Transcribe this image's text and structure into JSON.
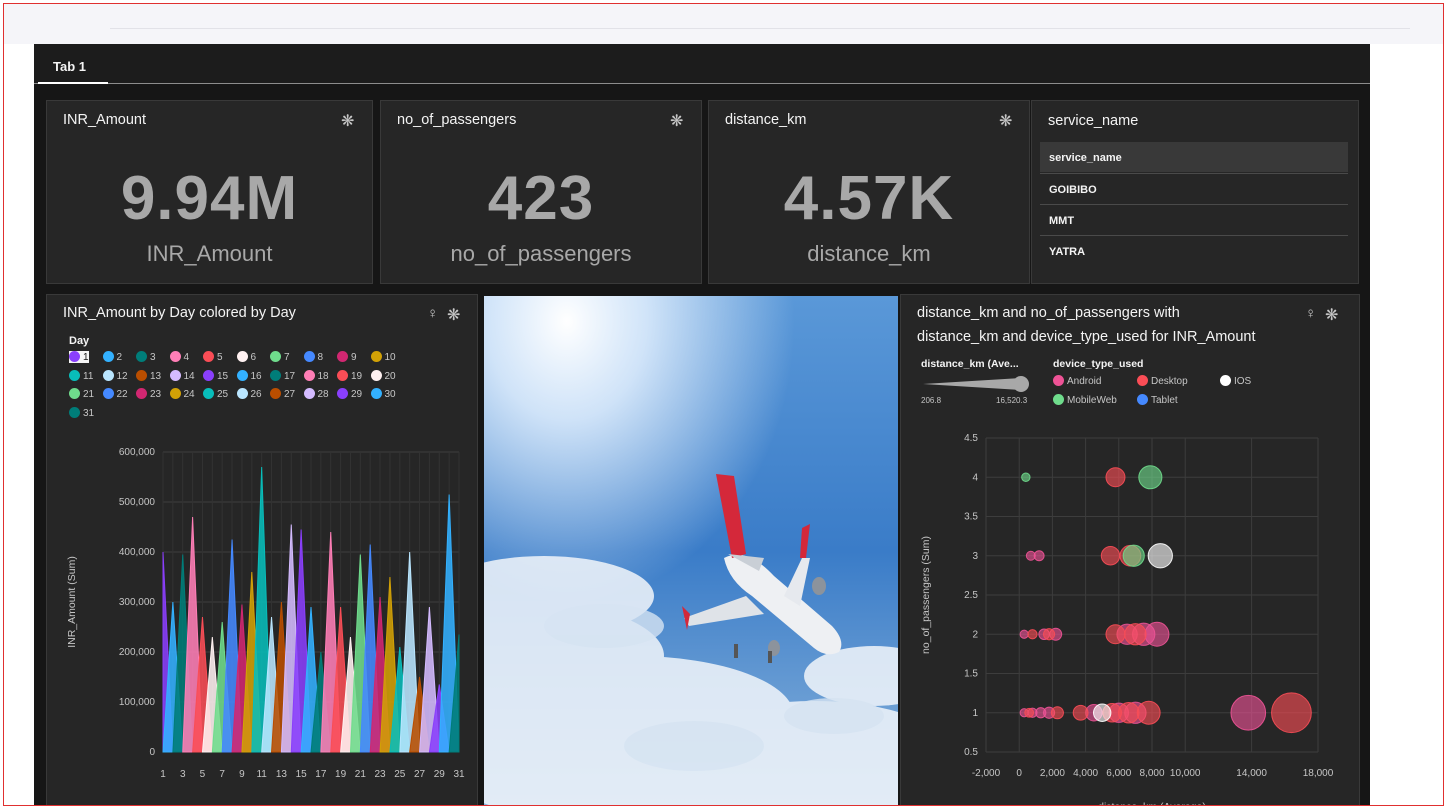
{
  "tabs": [
    {
      "label": "Tab 1"
    }
  ],
  "kpis": [
    {
      "title": "INR_Amount",
      "value": "9.94M",
      "label": "INR_Amount"
    },
    {
      "title": "no_of_passengers",
      "value": "423",
      "label": "no_of_passengers"
    },
    {
      "title": "distance_km",
      "value": "4.57K",
      "label": "distance_km"
    }
  ],
  "service": {
    "title": "service_name",
    "header": "service_name",
    "rows": [
      "GOIBIBO",
      "MMT",
      "YATRA"
    ]
  },
  "icons": {
    "settings": "gear-icon",
    "insights": "lightbulb-icon"
  },
  "bar_chart": {
    "title": "INR_Amount by Day colored by Day",
    "legend_title": "Day",
    "selected_day": "1"
  },
  "scatter": {
    "title_line1": "distance_km and no_of_passengers with",
    "title_line2": "distance_km and device_type_used for INR_Amount",
    "size_legend_title": "distance_km (Ave...",
    "size_min": "206.8",
    "size_max": "16,520.3",
    "color_legend_title": "device_type_used",
    "devices": [
      {
        "name": "Android",
        "color": "#ee5396"
      },
      {
        "name": "Desktop",
        "color": "#fa4d56"
      },
      {
        "name": "IOS",
        "color": "#ffffff"
      },
      {
        "name": "MobileWeb",
        "color": "#6fdc8c"
      },
      {
        "name": "Tablet",
        "color": "#4589ff"
      }
    ]
  },
  "day_colors": [
    "#8a3ffc",
    "#33b1ff",
    "#007d79",
    "#ff7eb6",
    "#fa4d56",
    "#fff1f1",
    "#6fdc8c",
    "#4589ff",
    "#d12771",
    "#d2a106",
    "#08bdba",
    "#bae6ff",
    "#ba4e00",
    "#d4bbff",
    "#8a3ffc",
    "#33b1ff",
    "#007d79",
    "#ff7eb6",
    "#fa4d56",
    "#fff1f1",
    "#6fdc8c",
    "#4589ff",
    "#d12771",
    "#d2a106",
    "#08bdba",
    "#bae6ff",
    "#ba4e00",
    "#d4bbff",
    "#8a3ffc",
    "#33b1ff",
    "#007d79"
  ],
  "chart_data": [
    {
      "type": "area",
      "title": "INR_Amount by Day colored by Day",
      "xlabel": "Day",
      "ylabel": "INR_Amount (Sum)",
      "ylim": [
        0,
        600000
      ],
      "y_ticks": [
        "0",
        "100,000",
        "200,000",
        "300,000",
        "400,000",
        "500,000",
        "600,000"
      ],
      "x_ticks": [
        "1",
        "3",
        "5",
        "7",
        "9",
        "11",
        "13",
        "15",
        "17",
        "19",
        "21",
        "23",
        "25",
        "27",
        "29",
        "31"
      ],
      "categories": [
        "1",
        "2",
        "3",
        "4",
        "5",
        "6",
        "7",
        "8",
        "9",
        "10",
        "11",
        "12",
        "13",
        "14",
        "15",
        "16",
        "17",
        "18",
        "19",
        "20",
        "21",
        "22",
        "23",
        "24",
        "25",
        "26",
        "27",
        "28",
        "29",
        "30",
        "31"
      ],
      "values": [
        400000,
        300000,
        395000,
        470000,
        270000,
        230000,
        260000,
        425000,
        295000,
        360000,
        570000,
        270000,
        300000,
        455000,
        445000,
        290000,
        200000,
        440000,
        290000,
        230000,
        395000,
        415000,
        310000,
        350000,
        210000,
        400000,
        150000,
        290000,
        135000,
        515000,
        235000
      ]
    },
    {
      "type": "scatter",
      "title": "distance_km and no_of_passengers with distance_km and device_type_used for INR_Amount",
      "xlabel": "distance_km (Average)",
      "ylabel": "no_of_passengers (Sum)",
      "xlim": [
        -2000,
        18000
      ],
      "ylim": [
        0.5,
        4.5
      ],
      "x_ticks": [
        "-2,000",
        "0",
        "2,000",
        "4,000",
        "6,000",
        "8,000",
        "10,000",
        "14,000",
        "18,000"
      ],
      "y_ticks": [
        "0.5",
        "1",
        "1.5",
        "2",
        "2.5",
        "3",
        "3.5",
        "4",
        "4.5"
      ],
      "series": [
        {
          "name": "Android",
          "points": [
            [
              300,
              1
            ],
            [
              800,
              1
            ],
            [
              1300,
              1
            ],
            [
              1800,
              1
            ],
            [
              4500,
              1
            ],
            [
              6000,
              1
            ],
            [
              7000,
              1
            ],
            [
              13800,
              1
            ],
            [
              300,
              2
            ],
            [
              1500,
              2
            ],
            [
              2200,
              2
            ],
            [
              6500,
              2
            ],
            [
              7500,
              2
            ],
            [
              8300,
              2
            ],
            [
              700,
              3
            ],
            [
              1200,
              3
            ]
          ]
        },
        {
          "name": "Desktop",
          "points": [
            [
              600,
              1
            ],
            [
              2300,
              1
            ],
            [
              3700,
              1
            ],
            [
              5600,
              1
            ],
            [
              6600,
              1
            ],
            [
              7800,
              1
            ],
            [
              16400,
              1
            ],
            [
              800,
              2
            ],
            [
              1800,
              2
            ],
            [
              5800,
              2
            ],
            [
              7000,
              2
            ],
            [
              5500,
              3
            ],
            [
              6700,
              3
            ],
            [
              5800,
              4
            ]
          ]
        },
        {
          "name": "IOS",
          "points": [
            [
              5000,
              1
            ],
            [
              8500,
              3
            ]
          ]
        },
        {
          "name": "MobileWeb",
          "points": [
            [
              6900,
              3
            ],
            [
              400,
              4
            ],
            [
              7900,
              4
            ]
          ]
        },
        {
          "name": "Tablet",
          "points": []
        }
      ]
    }
  ]
}
